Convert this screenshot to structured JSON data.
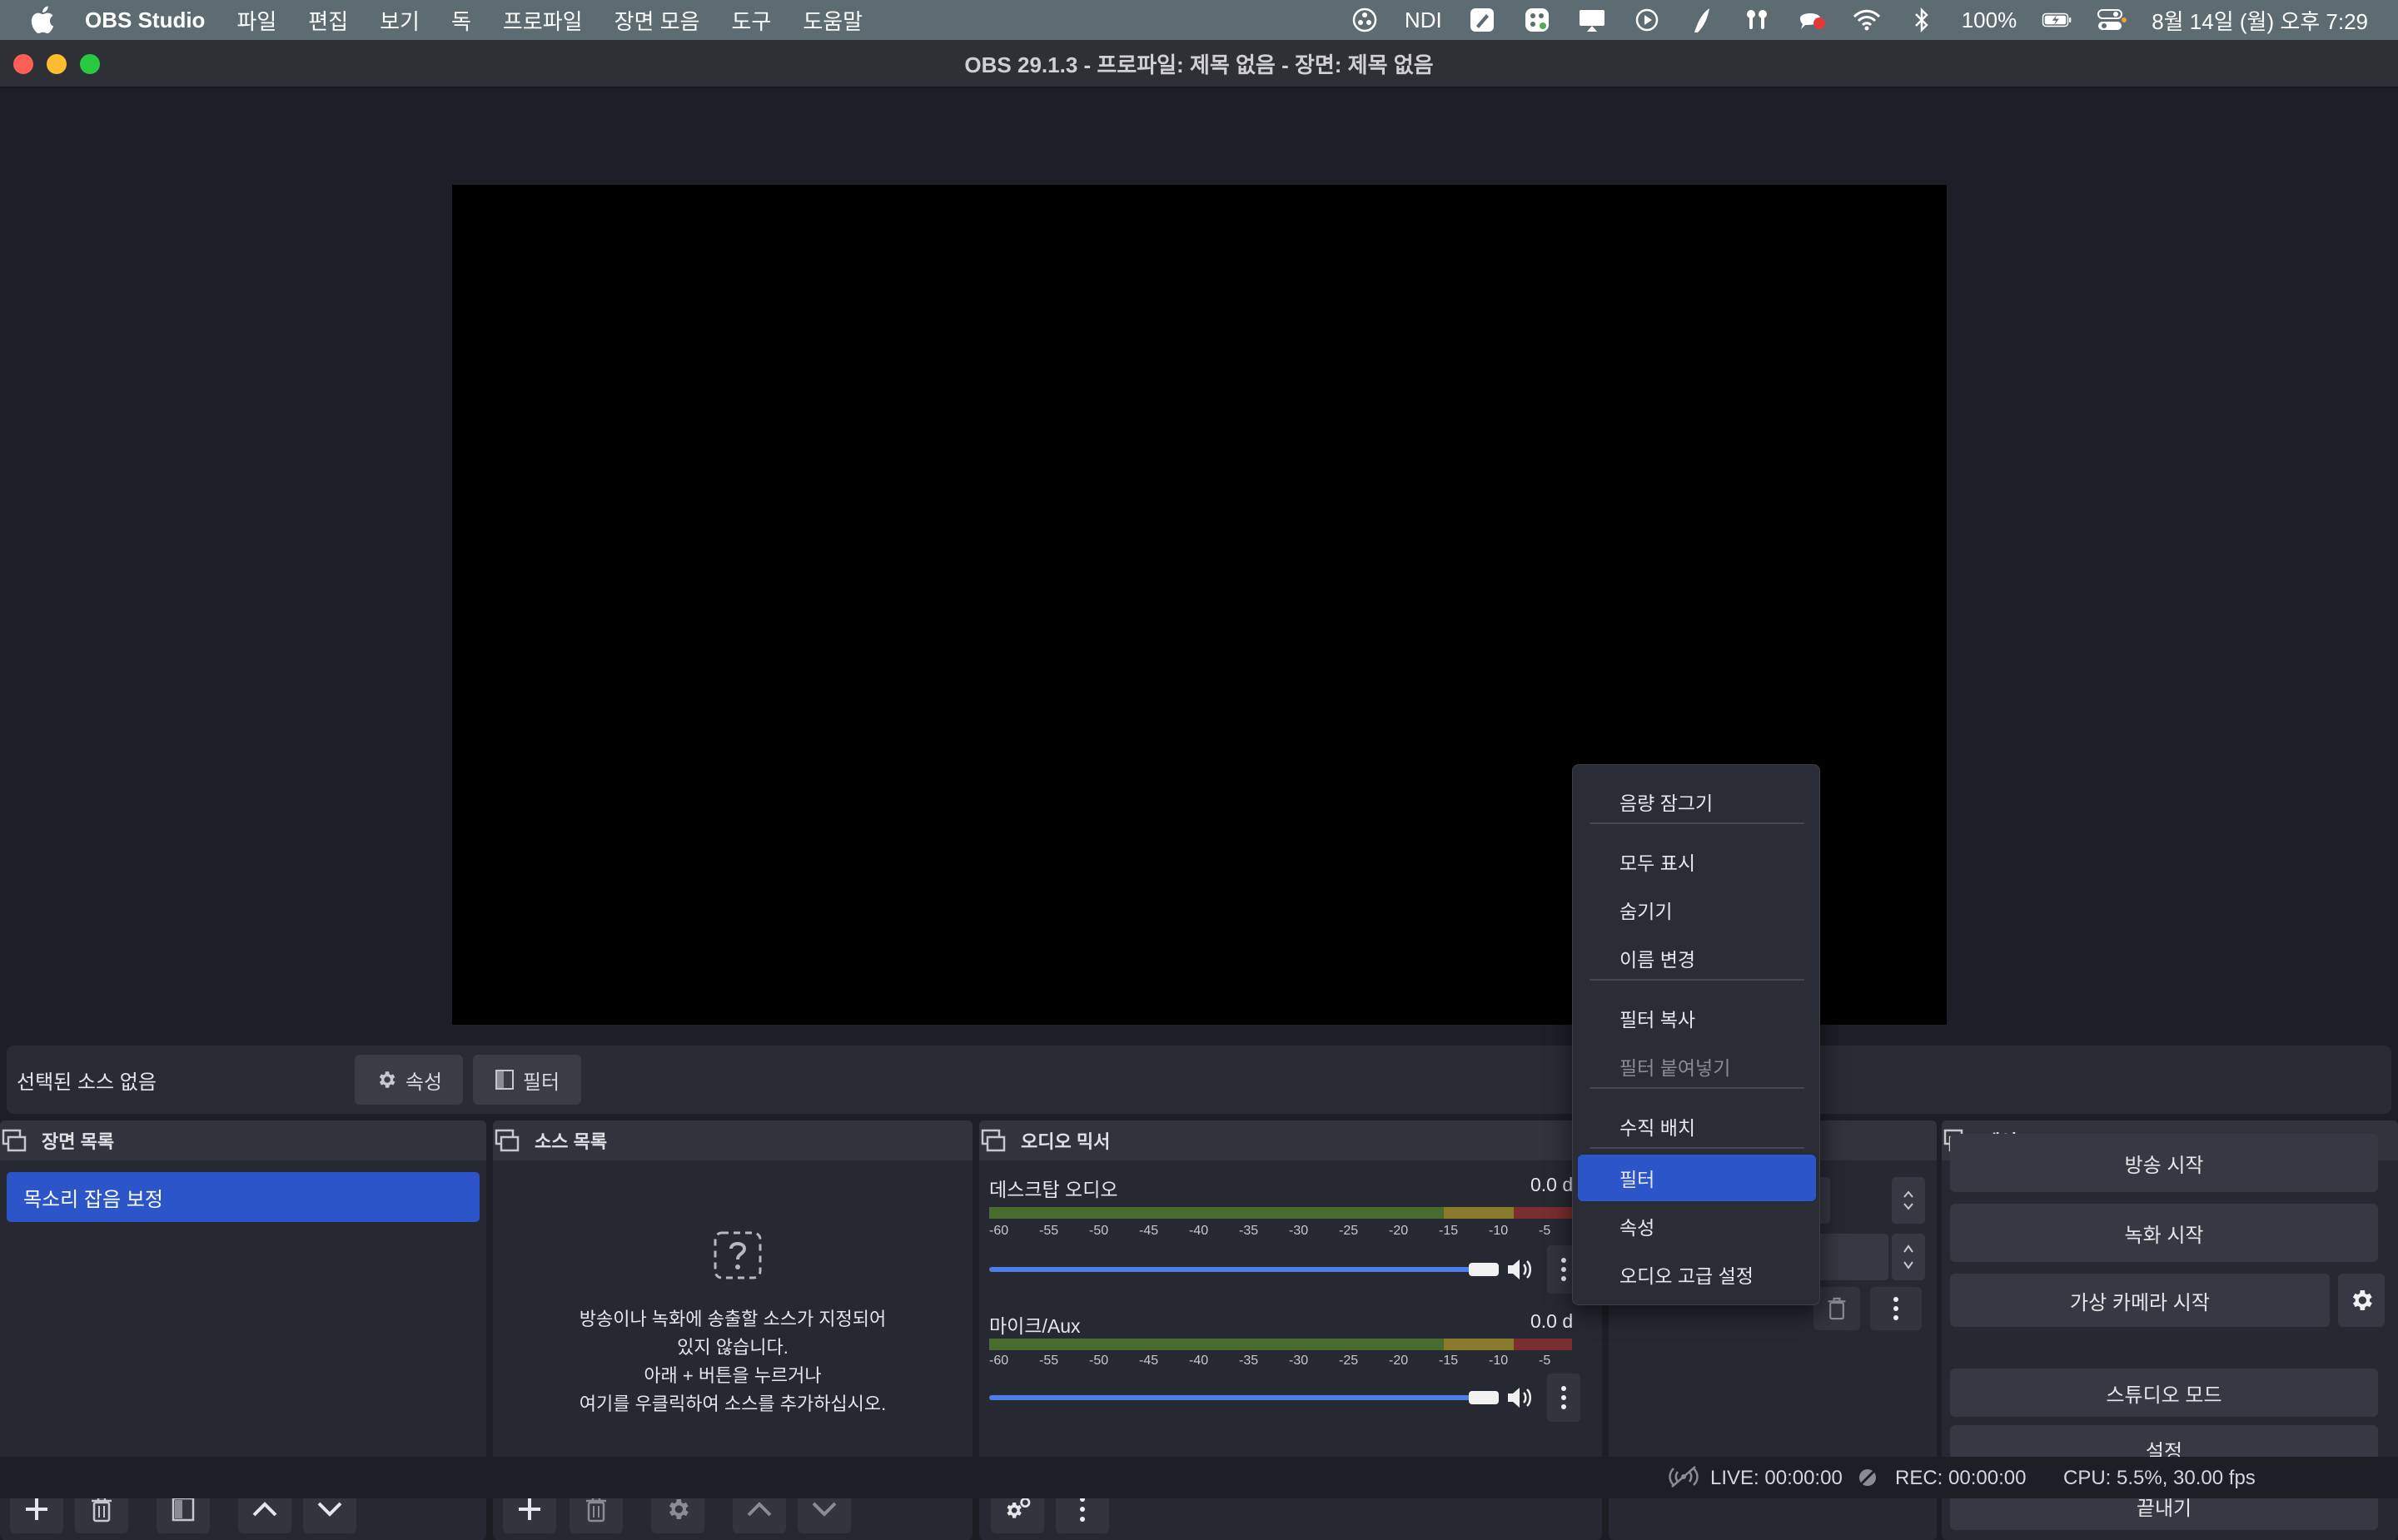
{
  "menubar": {
    "app_name": "OBS Studio",
    "items": [
      "파일",
      "편집",
      "보기",
      "독",
      "프로파일",
      "장면 모음",
      "도구",
      "도움말"
    ],
    "ndi": "NDI",
    "battery": "100%",
    "datetime": "8월 14일 (월) 오후 7:29"
  },
  "window": {
    "title": "OBS 29.1.3 - 프로파일: 제목 없음 - 장면: 제목 없음"
  },
  "source_bar": {
    "no_source": "선택된 소스 없음",
    "properties": "속성",
    "filters": "필터"
  },
  "scenes": {
    "title": "장면 목록",
    "items": [
      "목소리 잡음 보정"
    ]
  },
  "sources": {
    "title": "소스 목록",
    "empty_lines": [
      "방송이나 녹화에 송출할 소스가 지정되어",
      "있지 않습니다.",
      "아래 + 버튼을 누르거나",
      "여기를 우클릭하여 소스를 추가하십시오."
    ]
  },
  "audio_mixer": {
    "title": "오디오 믹서",
    "ticks": [
      "-60",
      "-55",
      "-50",
      "-45",
      "-40",
      "-35",
      "-30",
      "-25",
      "-20",
      "-15",
      "-10",
      "-5"
    ],
    "channels": [
      {
        "name": "데스크탑 오디오",
        "db": "0.0 d",
        "volume": 1.0
      },
      {
        "name": "마이크/Aux",
        "db": "0.0 d",
        "volume": 1.0
      }
    ]
  },
  "controls": {
    "title": "제어",
    "start_streaming": "방송 시작",
    "start_recording": "녹화 시작",
    "start_virtual_cam": "가상 카메라 시작",
    "studio_mode": "스튜디오 모드",
    "settings": "설정",
    "exit": "끝내기"
  },
  "context_menu": {
    "items": [
      "음량 잠그기",
      "모두 표시",
      "숨기기",
      "이름 변경",
      "필터 복사",
      "필터 붙여넣기",
      "수직 배치",
      "필터",
      "속성",
      "오디오 고급 설정"
    ],
    "disabled": "필터 붙여넣기",
    "selected": "필터"
  },
  "status": {
    "live": "LIVE: 00:00:00",
    "rec": "REC: 00:00:00",
    "cpu": "CPU: 5.5%, 30.00 fps"
  },
  "colors": {
    "accent": "#2c55c9",
    "menubar": "#5d6b73",
    "window_bg": "#1e1f26"
  }
}
